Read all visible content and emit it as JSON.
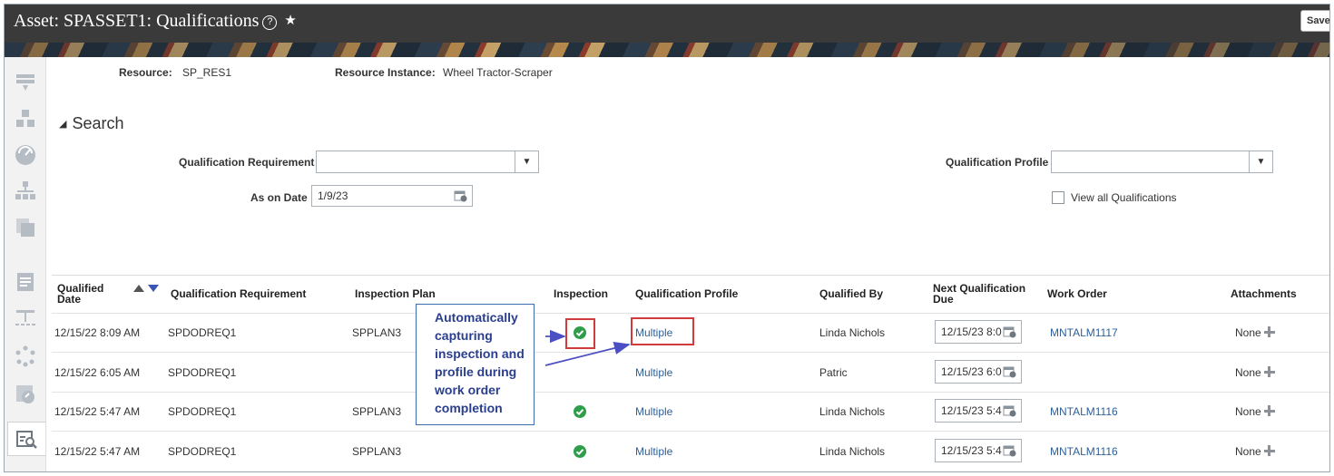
{
  "header": {
    "title": "Asset: SPASSET1: Qualifications",
    "save_label": "Save"
  },
  "resource": {
    "resource_label": "Resource:",
    "resource_value": "SP_RES1",
    "instance_label": "Resource Instance:",
    "instance_value": "Wheel Tractor-Scraper"
  },
  "search": {
    "title": "Search",
    "qual_req_label": "Qualification Requirement",
    "qual_req_value": "",
    "as_on_date_label": "As on Date",
    "as_on_date_value": "1/9/23",
    "qual_profile_label": "Qualification Profile",
    "qual_profile_value": "",
    "view_all_label": "View all Qualifications"
  },
  "table": {
    "columns": {
      "qualified_date": "Qualified Date",
      "requirement": "Qualification Requirement",
      "plan": "Inspection Plan",
      "inspection": "Inspection",
      "profile": "Qualification Profile",
      "qualified_by": "Qualified By",
      "next_due": "Next Qualification Due",
      "work_order": "Work Order",
      "attachments": "Attachments"
    },
    "rows": [
      {
        "date": "12/15/22 8:09 AM",
        "requirement": "SPDODREQ1",
        "plan": "SPPLAN3",
        "inspection": true,
        "profile": "Multiple",
        "by": "Linda Nichols",
        "due": "12/15/23 8:0",
        "work_order": "MNTALM1117",
        "attachments": "None"
      },
      {
        "date": "12/15/22 6:05 AM",
        "requirement": "SPDODREQ1",
        "plan": "",
        "inspection": false,
        "profile": "Multiple",
        "by": "Patric",
        "due": "12/15/23 6:0",
        "work_order": "",
        "attachments": "None"
      },
      {
        "date": "12/15/22 5:47 AM",
        "requirement": "SPDODREQ1",
        "plan": "SPPLAN3",
        "inspection": true,
        "profile": "Multiple",
        "by": "Linda Nichols",
        "due": "12/15/23 5:4",
        "work_order": "MNTALM1116",
        "attachments": "None"
      },
      {
        "date": "12/15/22 5:47 AM",
        "requirement": "SPDODREQ1",
        "plan": "SPPLAN3",
        "inspection": true,
        "profile": "Multiple",
        "by": "Linda Nichols",
        "due": "12/15/23 5:4",
        "work_order": "MNTALM1116",
        "attachments": "None"
      }
    ]
  },
  "annotation": {
    "lines": [
      "Automatically",
      "capturing",
      "inspection and",
      "profile during",
      "work order",
      "completion"
    ]
  },
  "colors": {
    "link": "#2d5f99",
    "success": "#2f9e4a",
    "highlight": "#d23b3b",
    "annotation": "#2a3e8f"
  }
}
